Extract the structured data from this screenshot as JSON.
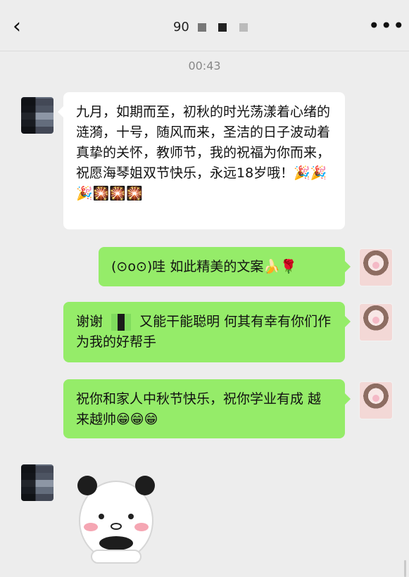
{
  "header": {
    "back_icon": "chevron-left-icon",
    "title_prefix": "90",
    "more_icon": "more-horizontal-icon"
  },
  "timestamp": "00:43",
  "messages": [
    {
      "side": "in",
      "text": "九月，如期而至，初秋的时光荡漾着心绪的涟漪，十号，随风而来，圣洁的日子波动着真挚的关怀，教师节，我的祝福为你而来，祝愿海琴姐双节快乐，永远18岁哦！🎉🎉🎉🎇🎇🎇"
    },
    {
      "side": "out",
      "text": "(⊙o⊙)哇  如此精美的文案🍌🌹"
    },
    {
      "side": "out",
      "text_before": "谢谢",
      "text_after": "又能干能聪明  何其有幸有你们作为我的好帮手"
    },
    {
      "side": "out",
      "text": "祝你和家人中秋节快乐，祝你学业有成 越来越帅😁😁😁"
    }
  ],
  "sticker": {
    "type": "panda-sticker"
  },
  "colors": {
    "background": "#ededed",
    "incoming": "#ffffff",
    "outgoing": "#95ec69"
  }
}
